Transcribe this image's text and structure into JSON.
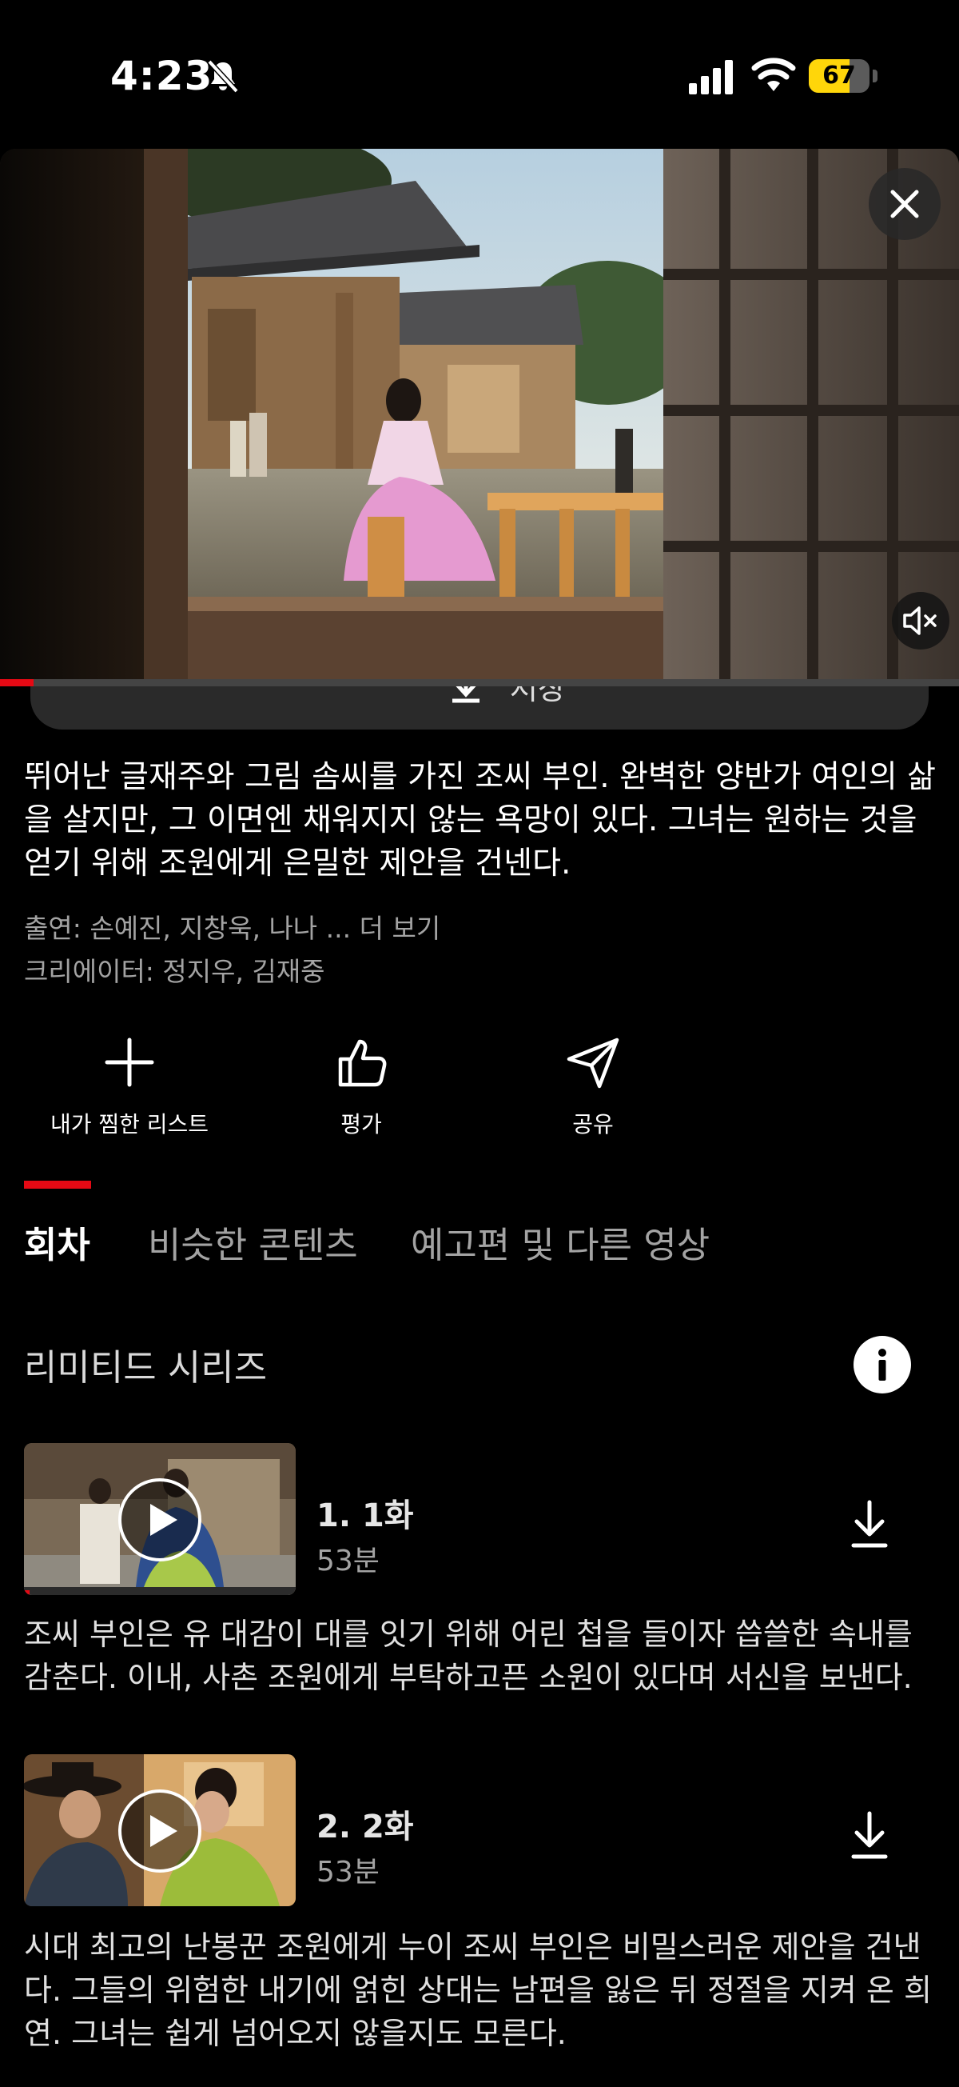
{
  "status_bar": {
    "time": "4:23",
    "battery_level": "67",
    "battery_fraction": 0.67,
    "battery_color": "#ffd60a",
    "icons": [
      "bell-slash-icon",
      "cellular-signal-icon",
      "wifi-icon",
      "battery-icon"
    ]
  },
  "video": {
    "progress_fraction": 0.035,
    "accent_color": "#e50914",
    "close_icon": "close-icon",
    "mute_icon": "speaker-muted-icon"
  },
  "partially_hidden_button": {
    "label": "저장",
    "icon": "download-icon"
  },
  "description": "뛰어난 글재주와 그림 솜씨를 가진 조씨 부인. 완벽한 양반가 여인의 삶을 살지만, 그 이면엔 채워지지 않는 욕망이 있다. 그녀는 원하는 것을 얻기 위해 조원에게 은밀한 제안을 건넨다.",
  "cast": {
    "text": "출연: 손예진, 지창욱, 나나 ",
    "ellipsis": "...",
    "more": " 더 보기"
  },
  "creators": "크리에이터: 정지우, 김재중",
  "actions": [
    {
      "label": "내가 찜한 리스트",
      "icon": "plus-icon"
    },
    {
      "label": "평가",
      "icon": "thumbs-up-icon"
    },
    {
      "label": "공유",
      "icon": "send-icon"
    }
  ],
  "tabs": [
    {
      "label": "회차",
      "active": true
    },
    {
      "label": "비슷한 콘텐츠",
      "active": false
    },
    {
      "label": "예고편 및 다른 영상",
      "active": false
    }
  ],
  "series": {
    "label": "리미티드 시리즈",
    "info_icon": "info-icon"
  },
  "episodes": [
    {
      "title": "1. 1화",
      "duration": "53분",
      "description": "조씨 부인은 유 대감이 대를 잇기 위해 어린 첩을 들이자 씁쓸한 속내를 감춘다. 이내, 사촌 조원에게 부탁하고픈 소원이 있다며 서신을 보낸다.",
      "watched_fraction": 0.02
    },
    {
      "title": "2. 2화",
      "duration": "53분",
      "description": "시대 최고의 난봉꾼 조원에게 누이 조씨 부인은 비밀스러운 제안을 건낸다. 그들의 위험한 내기에 얽힌 상대는 남편을 잃은 뒤 정절을 지켜 온 희연. 그녀는 쉽게 넘어오지 않을지도 모른다.",
      "watched_fraction": 0
    }
  ]
}
